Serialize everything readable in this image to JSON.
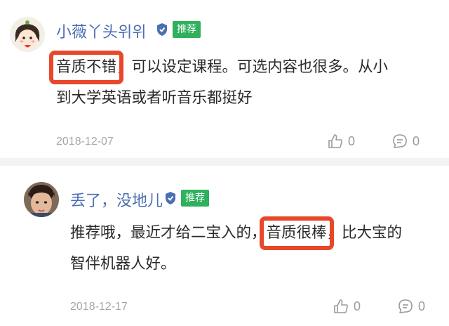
{
  "comments": [
    {
      "username": "小薇丫头위위",
      "badge": "推荐",
      "text_highlight": "音质不错",
      "text_line1_rest": "，可以设定课程。可选内容也很多。从小",
      "text_line2": "到大学英语或者听音乐都挺好",
      "date": "2018-12-07",
      "likes": "0",
      "replies": "0",
      "avatar_icon": "cartoon-girl-avatar",
      "verified_icon": "shield-icon"
    },
    {
      "username": "丢了，没地儿",
      "badge": "推荐",
      "text_line1_before": "推荐哦，最近才给二宝入的，",
      "text_highlight": "音质很棒",
      "text_line1_after": "，比大宝的",
      "text_line2": "智伴机器人好。",
      "date": "2018-12-17",
      "likes": "0",
      "replies": "0",
      "avatar_icon": "child-photo-avatar",
      "verified_icon": "shield-icon"
    }
  ],
  "colors": {
    "username": "#4a6fb2",
    "badge_bg": "#2fb05c",
    "highlight_box": "#e8472a",
    "meta": "#a7a7a7"
  }
}
